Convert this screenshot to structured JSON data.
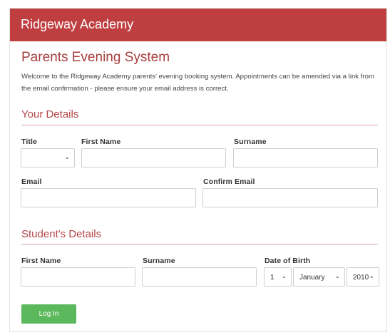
{
  "header": {
    "brand": "Ridgeway Academy"
  },
  "page": {
    "title": "Parents Evening System",
    "intro": "Welcome to the Ridgeway Academy parents' evening booking system. Appointments can be amended via a link from the email confirmation - please ensure your email address is correct."
  },
  "your_details": {
    "heading": "Your Details",
    "title_label": "Title",
    "title_value": "",
    "first_name_label": "First Name",
    "first_name_value": "",
    "surname_label": "Surname",
    "surname_value": "",
    "email_label": "Email",
    "email_value": "",
    "confirm_email_label": "Confirm Email",
    "confirm_email_value": ""
  },
  "student_details": {
    "heading": "Student's Details",
    "first_name_label": "First Name",
    "first_name_value": "",
    "surname_label": "Surname",
    "surname_value": "",
    "dob_label": "Date of Birth",
    "dob_day": "1",
    "dob_month": "January",
    "dob_year": "2010"
  },
  "actions": {
    "login_label": "Log In"
  },
  "colors": {
    "brand": "#bf3f41",
    "button": "#5cb85c"
  },
  "icons": {
    "select_arrow": "chevron-down-icon"
  }
}
